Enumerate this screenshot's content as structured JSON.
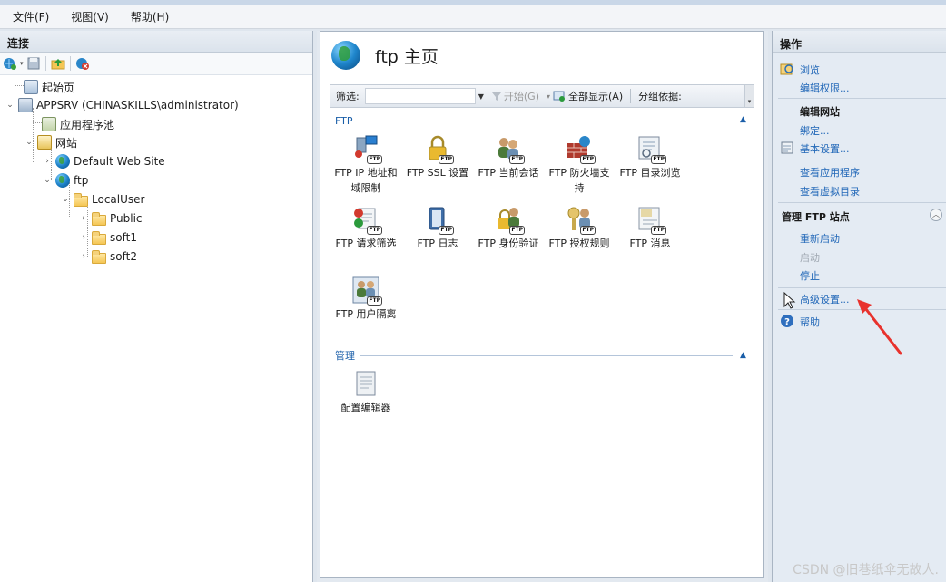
{
  "menubar": {
    "items": [
      "文件(F)",
      "视图(V)",
      "帮助(H)"
    ]
  },
  "connections": {
    "title": "连接",
    "tree": {
      "start_page": "起始页",
      "server": "APPSRV (CHINASKILLS\\administrator)",
      "app_pools": "应用程序池",
      "sites": "网站",
      "default_site": "Default Web Site",
      "ftp_site": "ftp",
      "local_user": "LocalUser",
      "public": "Public",
      "soft1": "soft1",
      "soft2": "soft2"
    }
  },
  "center": {
    "title": "ftp 主页",
    "filter": {
      "label": "筛选:",
      "value": "",
      "start_label": "开始(G)",
      "show_all_label": "全部显示(A)",
      "group_by_label": "分组依据:"
    },
    "groups": {
      "ftp": "FTP",
      "manage": "管理"
    },
    "features": [
      {
        "label": "FTP IP 地址和域限制",
        "icon": "ftp-ip-restriction-icon"
      },
      {
        "label": "FTP SSL 设置",
        "icon": "ftp-ssl-icon"
      },
      {
        "label": "FTP 当前会话",
        "icon": "ftp-sessions-icon"
      },
      {
        "label": "FTP 防火墙支持",
        "icon": "ftp-firewall-icon"
      },
      {
        "label": "FTP 目录浏览",
        "icon": "ftp-directory-browsing-icon"
      },
      {
        "label": "FTP 请求筛选",
        "icon": "ftp-request-filtering-icon"
      },
      {
        "label": "FTP 日志",
        "icon": "ftp-logging-icon"
      },
      {
        "label": "FTP 身份验证",
        "icon": "ftp-authentication-icon"
      },
      {
        "label": "FTP 授权规则",
        "icon": "ftp-authorization-icon"
      },
      {
        "label": "FTP 消息",
        "icon": "ftp-messages-icon"
      },
      {
        "label": "FTP 用户隔离",
        "icon": "ftp-user-isolation-icon"
      }
    ],
    "manage_features": [
      {
        "label": "配置编辑器",
        "icon": "configuration-editor-icon"
      }
    ]
  },
  "actions": {
    "title": "操作",
    "browse": "浏览",
    "edit_permissions": "编辑权限...",
    "edit_site_title": "编辑网站",
    "bindings": "绑定...",
    "basic_settings": "基本设置...",
    "view_applications": "查看应用程序",
    "view_virtual_dirs": "查看虚拟目录",
    "manage_ftp_title": "管理 FTP 站点",
    "restart": "重新启动",
    "start": "启动",
    "stop": "停止",
    "advanced_settings": "高级设置...",
    "help": "帮助"
  },
  "annotation": {
    "arrow_color": "#e8322d"
  },
  "watermark": "CSDN @旧巷纸伞无故人."
}
